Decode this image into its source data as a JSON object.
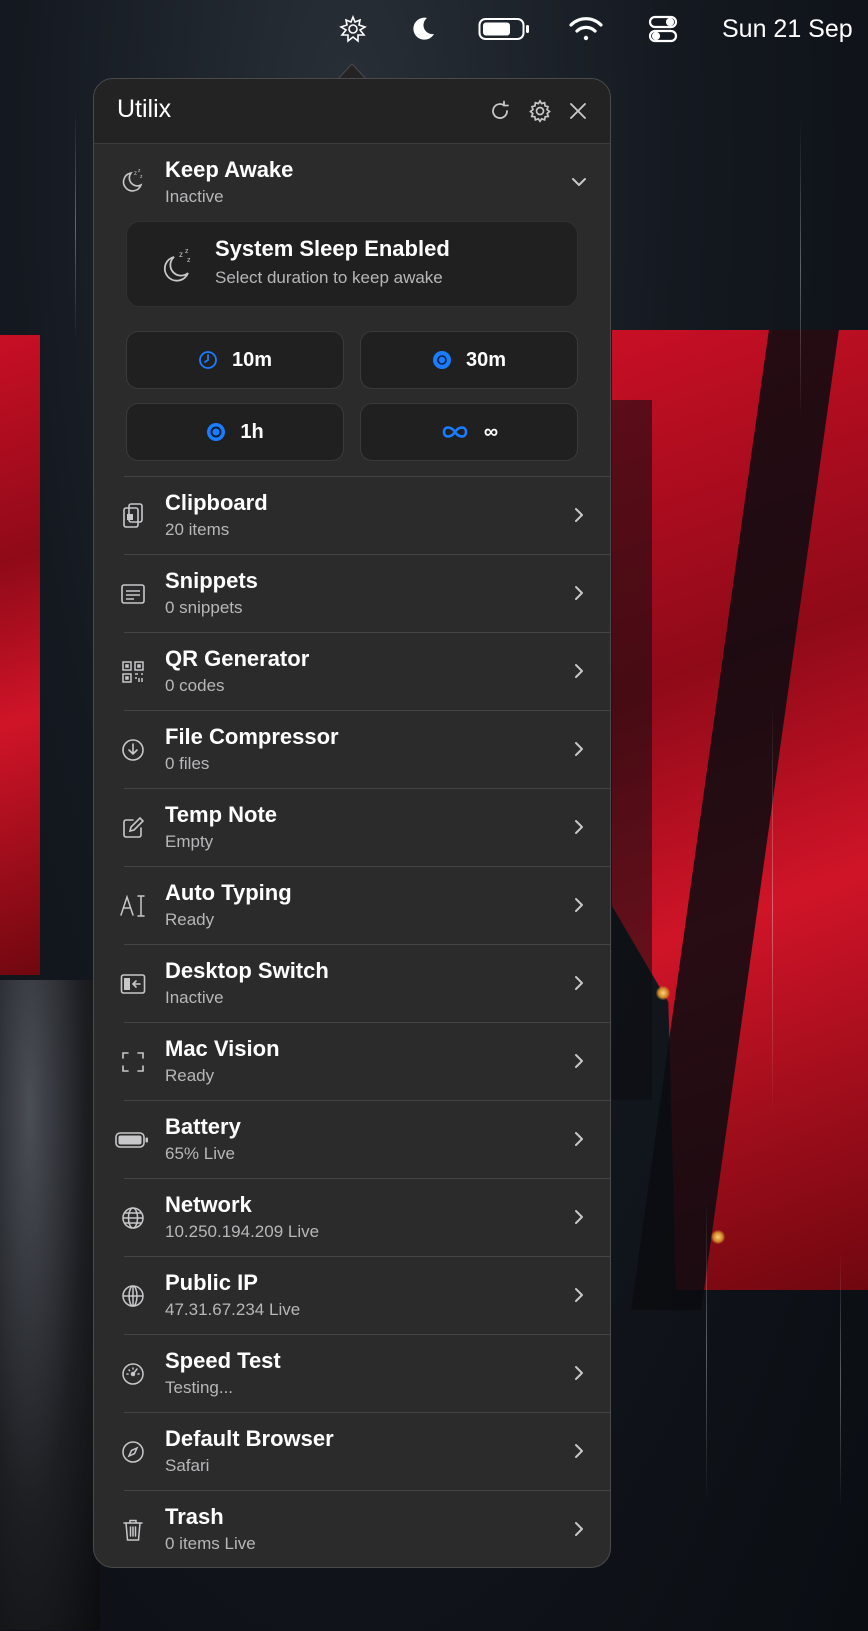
{
  "menubar": {
    "date": "Sun 21 Sep",
    "icons": [
      "utilix-app-icon",
      "moon-icon",
      "battery-icon",
      "wifi-icon",
      "control-center-icon"
    ]
  },
  "panel": {
    "title": "Utilix",
    "header_icons": [
      "refresh-icon",
      "gear-icon",
      "close-icon"
    ]
  },
  "keep_awake": {
    "title": "Keep Awake",
    "status": "Inactive",
    "card_title": "System Sleep Enabled",
    "card_subtitle": "Select duration to keep awake",
    "durations": [
      {
        "label": "10m",
        "icon": "clock-icon"
      },
      {
        "label": "30m",
        "icon": "clock-filled-icon"
      },
      {
        "label": "1h",
        "icon": "clock-filled-icon"
      },
      {
        "label": "∞",
        "icon": "infinity-icon"
      }
    ]
  },
  "tools": [
    {
      "title": "Clipboard",
      "subtitle": "20 items",
      "icon": "clipboard-icon"
    },
    {
      "title": "Snippets",
      "subtitle": "0 snippets",
      "icon": "snippets-icon"
    },
    {
      "title": "QR Generator",
      "subtitle": "0 codes",
      "icon": "qr-code-icon"
    },
    {
      "title": "File Compressor",
      "subtitle": "0 files",
      "icon": "download-circle-icon"
    },
    {
      "title": "Temp Note",
      "subtitle": "Empty",
      "icon": "note-edit-icon"
    },
    {
      "title": "Auto Typing",
      "subtitle": "Ready",
      "icon": "text-cursor-icon"
    },
    {
      "title": "Desktop Switch",
      "subtitle": "Inactive",
      "icon": "desktop-switch-icon"
    },
    {
      "title": "Mac Vision",
      "subtitle": "Ready",
      "icon": "viewfinder-icon"
    },
    {
      "title": "Battery",
      "subtitle": "65% Live",
      "icon": "battery-icon"
    },
    {
      "title": "Network",
      "subtitle": "10.250.194.209 Live",
      "icon": "globe-icon"
    },
    {
      "title": "Public IP",
      "subtitle": "47.31.67.234 Live",
      "icon": "globe-grid-icon"
    },
    {
      "title": "Speed Test",
      "subtitle": "Testing...",
      "icon": "speedometer-icon"
    },
    {
      "title": "Default Browser",
      "subtitle": "Safari",
      "icon": "compass-icon"
    },
    {
      "title": "Trash",
      "subtitle": "0 items Live",
      "icon": "trash-icon"
    }
  ],
  "colors": {
    "accent": "#1a7cff",
    "panel_bg": "#2b2b2c",
    "card_bg": "#202021",
    "wallpaper_red": "#c80f25"
  }
}
